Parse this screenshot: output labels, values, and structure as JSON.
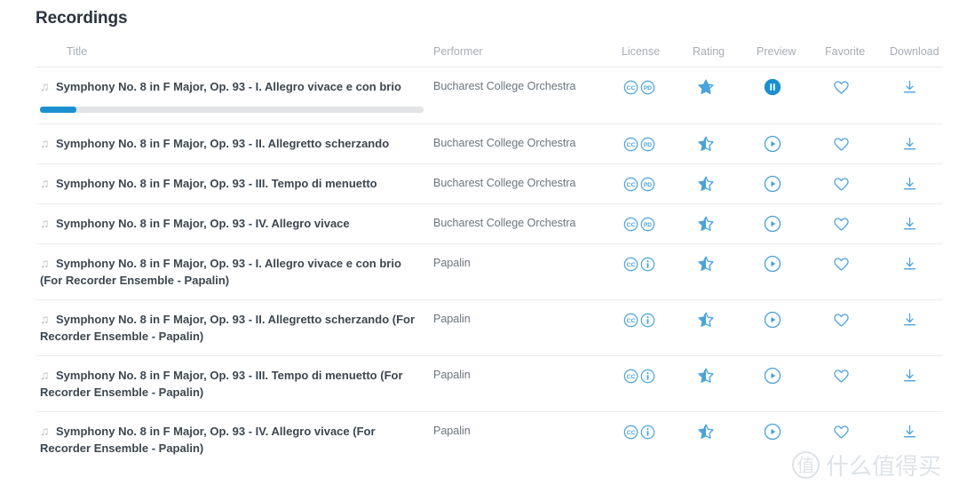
{
  "page": {
    "title": "Recordings"
  },
  "table": {
    "columns": {
      "title": "Title",
      "performer": "Performer",
      "license": "License",
      "rating": "Rating",
      "preview": "Preview",
      "favorite": "Favorite",
      "download": "Download"
    },
    "rows": [
      {
        "title": "Symphony No. 8 in F Major, Op. 93 - I. Allegro vivace e con brio",
        "performer": "Bucharest College Orchestra",
        "license": [
          "CC",
          "PD"
        ],
        "rating": "star-three-quarter",
        "preview": "pause-filled",
        "favorite": "heart-outline",
        "download": "download-icon",
        "playing": true,
        "progress_percent": 9.5
      },
      {
        "title": "Symphony No. 8 in F Major, Op. 93 - II. Allegretto scherzando",
        "performer": "Bucharest College Orchestra",
        "license": [
          "CC",
          "PD"
        ],
        "rating": "star-half",
        "preview": "play-outline",
        "favorite": "heart-outline",
        "download": "download-icon",
        "playing": false,
        "progress_percent": 0
      },
      {
        "title": "Symphony No. 8 in F Major, Op. 93 - III. Tempo di menuetto",
        "performer": "Bucharest College Orchestra",
        "license": [
          "CC",
          "PD"
        ],
        "rating": "star-half",
        "preview": "play-outline",
        "favorite": "heart-outline",
        "download": "download-icon",
        "playing": false,
        "progress_percent": 0
      },
      {
        "title": "Symphony No. 8 in F Major, Op. 93 - IV. Allegro vivace",
        "performer": "Bucharest College Orchestra",
        "license": [
          "CC",
          "PD"
        ],
        "rating": "star-half",
        "preview": "play-outline",
        "favorite": "heart-outline",
        "download": "download-icon",
        "playing": false,
        "progress_percent": 0
      },
      {
        "title": "Symphony No. 8 in F Major, Op. 93 - I. Allegro vivace e con brio (For Recorder Ensemble - Papalin)",
        "performer": "Papalin",
        "license": [
          "CC",
          "BY"
        ],
        "rating": "star-half",
        "preview": "play-outline",
        "favorite": "heart-outline",
        "download": "download-icon",
        "playing": false,
        "progress_percent": 0
      },
      {
        "title": "Symphony No. 8 in F Major, Op. 93 - II. Allegretto scherzando (For Recorder Ensemble - Papalin)",
        "performer": "Papalin",
        "license": [
          "CC",
          "BY"
        ],
        "rating": "star-half",
        "preview": "play-outline",
        "favorite": "heart-outline",
        "download": "download-icon",
        "playing": false,
        "progress_percent": 0
      },
      {
        "title": "Symphony No. 8 in F Major, Op. 93 - III. Tempo di menuetto (For Recorder Ensemble - Papalin)",
        "performer": "Papalin",
        "license": [
          "CC",
          "BY"
        ],
        "rating": "star-half",
        "preview": "play-outline",
        "favorite": "heart-outline",
        "download": "download-icon",
        "playing": false,
        "progress_percent": 0
      },
      {
        "title": "Symphony No. 8 in F Major, Op. 93 - IV. Allegro vivace (For Recorder Ensemble - Papalin)",
        "performer": "Papalin",
        "license": [
          "CC",
          "BY"
        ],
        "rating": "star-half",
        "preview": "play-outline",
        "favorite": "heart-outline",
        "download": "download-icon",
        "playing": false,
        "progress_percent": 0
      }
    ]
  },
  "watermark": {
    "mark": "值",
    "text": "什么值得买"
  },
  "colors": {
    "accent": "#1b8fd0",
    "icon_blue": "#4aa3dc",
    "title_text": "#3d4650",
    "muted_text": "#a7adb4",
    "performer_text": "#6b747e",
    "divider": "#ececec",
    "progress_track": "#e3e4e6"
  },
  "icons": {
    "note": "♫"
  }
}
